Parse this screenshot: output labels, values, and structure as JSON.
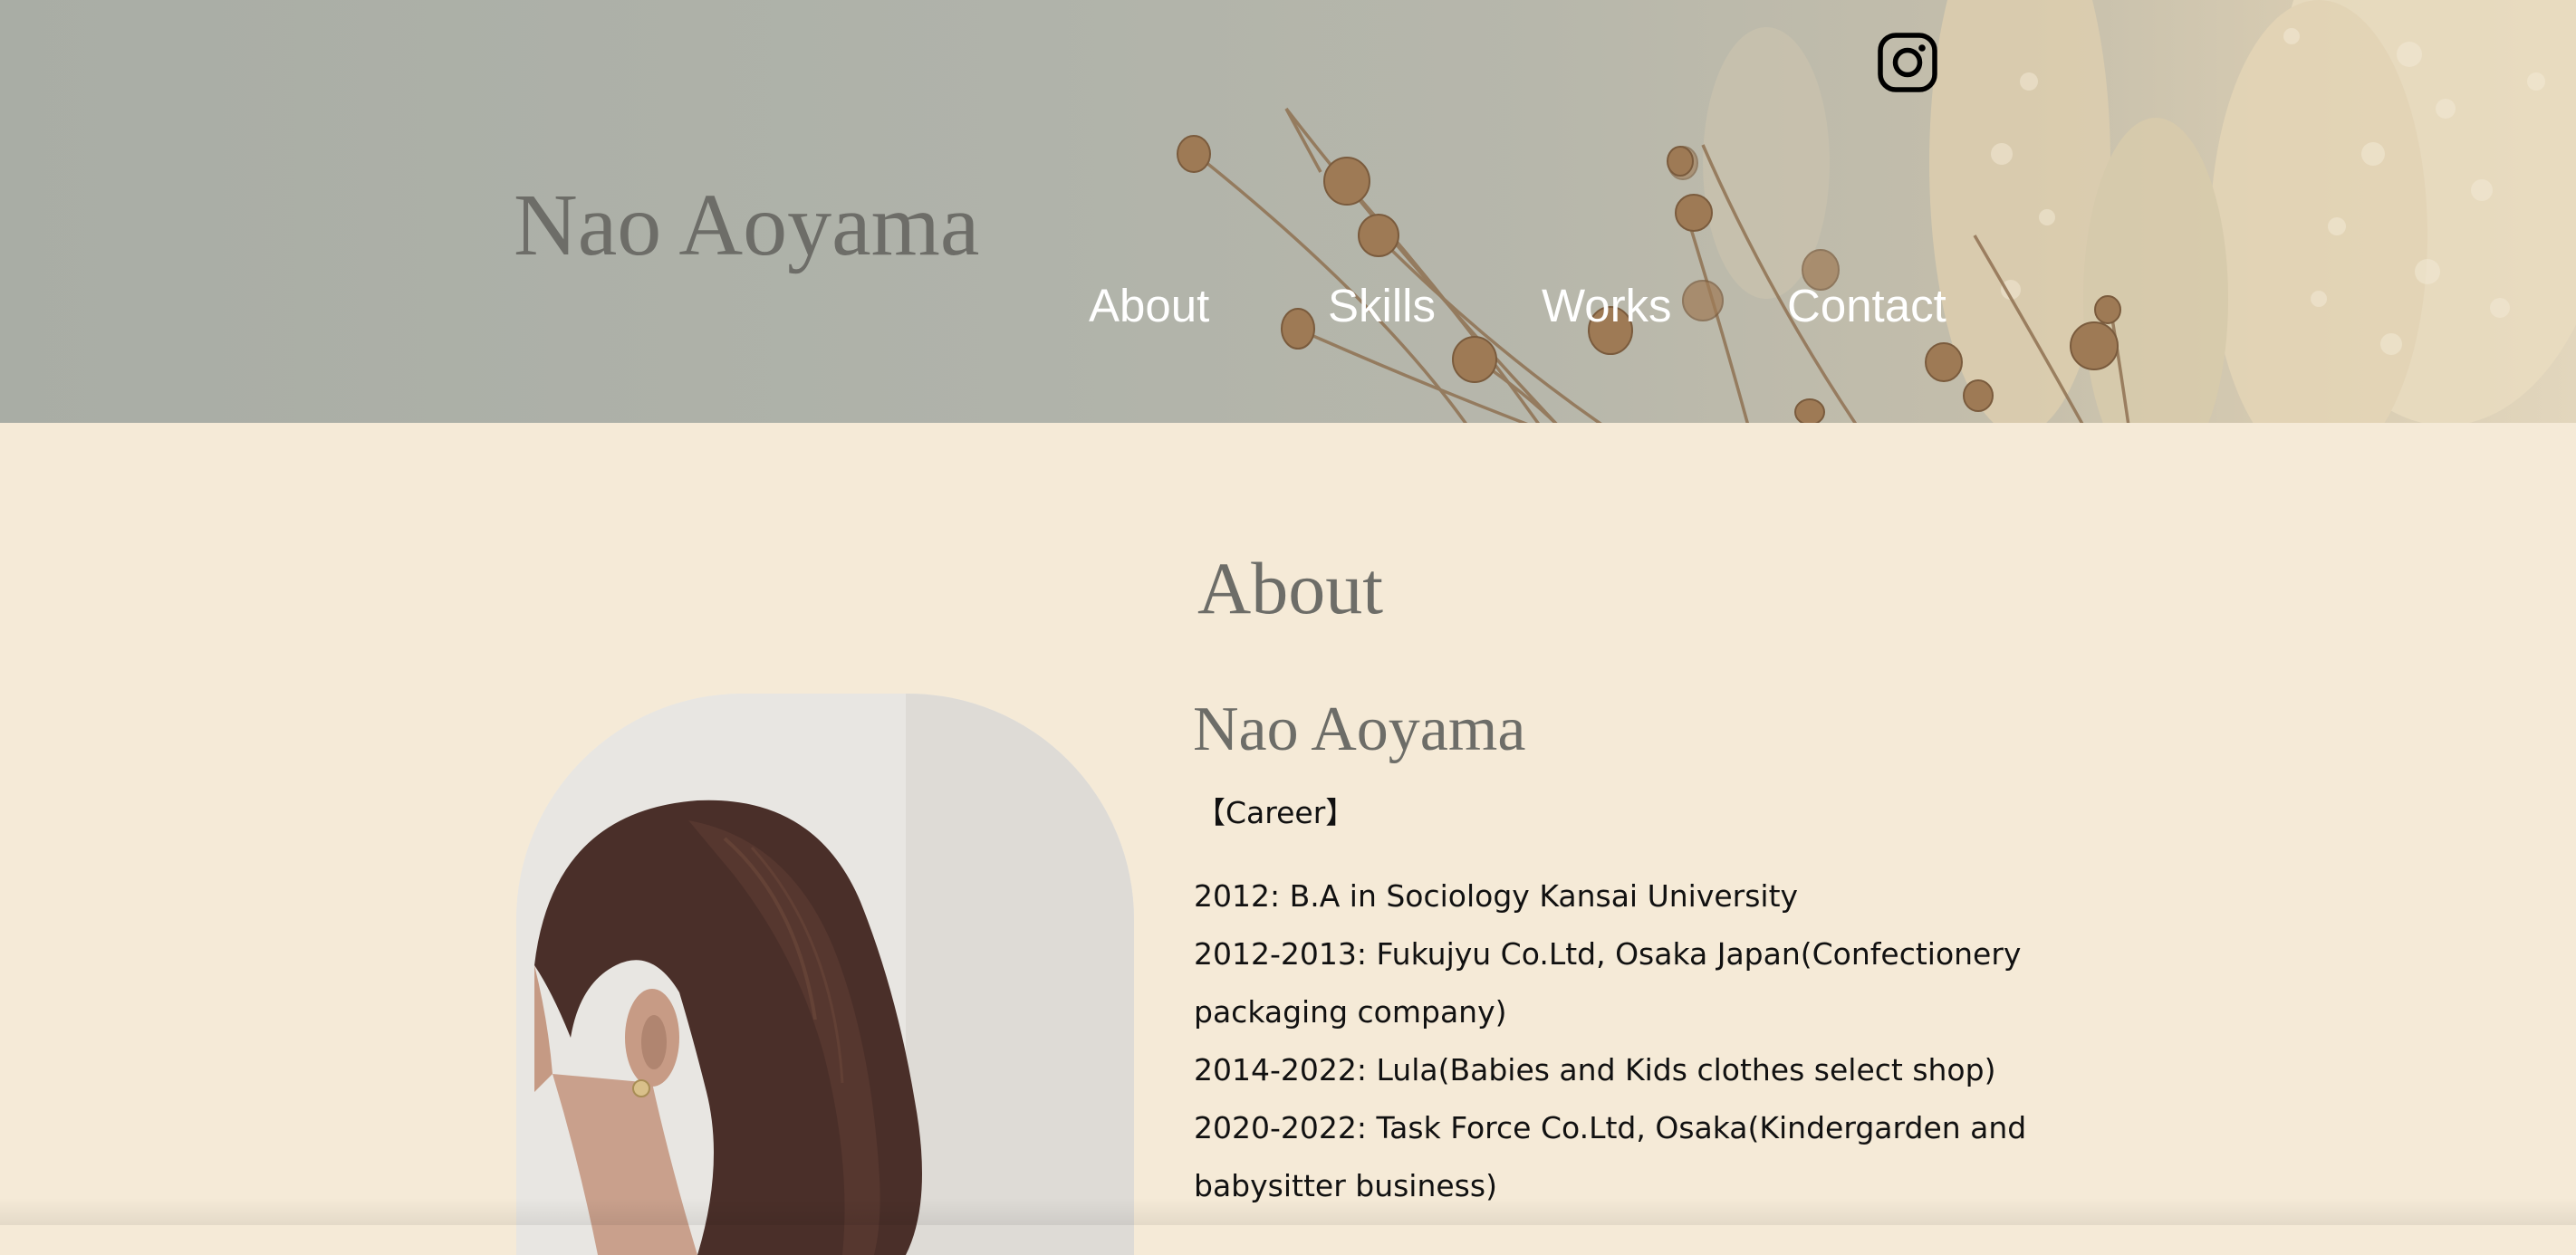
{
  "header": {
    "brand": "Nao Aoyama",
    "social_icon": "instagram-icon",
    "nav": [
      {
        "label": "About"
      },
      {
        "label": "Skills"
      },
      {
        "label": "Works"
      },
      {
        "label": "Contact"
      }
    ]
  },
  "about": {
    "title": "About",
    "name": "Nao Aoyama",
    "career_label": "【Career】",
    "career": [
      "2012: B.A in Sociology Kansai University",
      "2012-2013: Fukujyu Co.Ltd, Osaka Japan(Confectionery packaging company)",
      "2014-2022: Lula(Babies and Kids clothes select shop)",
      "2020-2022: Task Force Co.Ltd, Osaka(Kindergarden and babysitter business)"
    ]
  },
  "colors": {
    "hero_bg": "#afb2a9",
    "page_bg": "#f5ead7",
    "heading": "#6d6d68",
    "nav_text": "#ffffff",
    "body_text": "#111111"
  }
}
